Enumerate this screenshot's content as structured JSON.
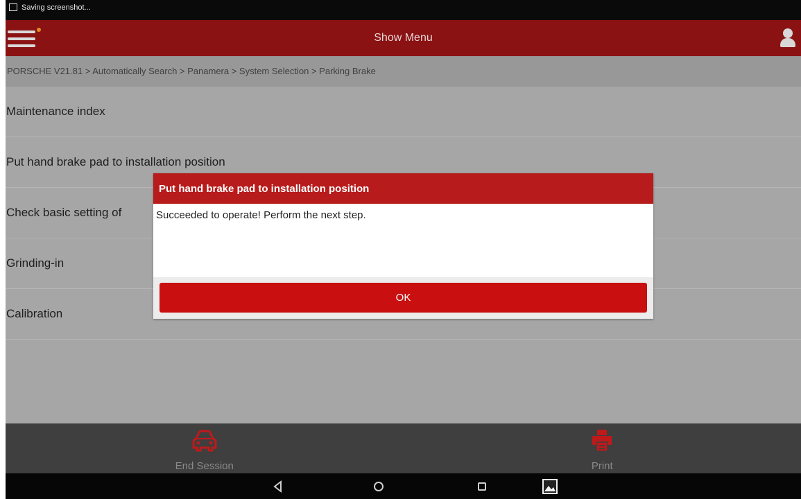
{
  "status_bar": {
    "notification": "Saving screenshot..."
  },
  "header": {
    "title": "Show Menu"
  },
  "breadcrumb": "PORSCHE V21.81 > Automatically Search > Panamera > System Selection > Parking Brake",
  "menu": {
    "items": [
      {
        "label": "Maintenance index"
      },
      {
        "label": "Put hand brake pad to installation position"
      },
      {
        "label": "Check basic setting of"
      },
      {
        "label": "Grinding-in"
      },
      {
        "label": "Calibration"
      }
    ]
  },
  "dialog": {
    "title": "Put hand brake pad to installation position",
    "message": "Succeeded to operate! Perform the next step.",
    "ok_label": "OK"
  },
  "toolbar": {
    "end_session_label": "End Session",
    "print_label": "Print"
  },
  "colors": {
    "header": "#8a1213",
    "dialog_header": "#b81b1b",
    "accent": "#c90f0f"
  },
  "icons": [
    "menu-icon",
    "user-icon",
    "car-icon",
    "printer-icon",
    "back-icon",
    "home-icon",
    "recents-icon",
    "screenshot-icon"
  ]
}
